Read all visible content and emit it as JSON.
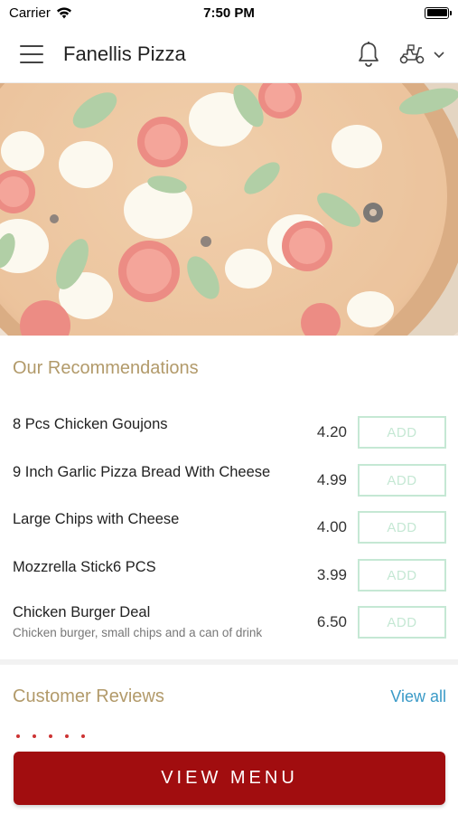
{
  "status_bar": {
    "carrier": "Carrier",
    "time": "7:50 PM"
  },
  "header": {
    "title": "Fanellis Pizza",
    "menu_icon": "hamburger-menu-icon",
    "bell_icon": "bell-icon",
    "delivery_icon": "scooter-icon",
    "dropdown_icon": "chevron-down-icon"
  },
  "hero": {
    "image": "pizza-photo"
  },
  "recommendations": {
    "title": "Our Recommendations",
    "items": [
      {
        "name": "8 Pcs Chicken Goujons",
        "description": "",
        "price": "4.20",
        "button": "ADD"
      },
      {
        "name": "9 Inch Garlic Pizza Bread With Cheese",
        "description": "",
        "price": "4.99",
        "button": "ADD"
      },
      {
        "name": "Large Chips with Cheese",
        "description": "",
        "price": "4.00",
        "button": "ADD"
      },
      {
        "name": "Mozzrella Stick6 PCS",
        "description": "",
        "price": "3.99",
        "button": "ADD"
      },
      {
        "name": "Chicken Burger Deal",
        "description": "Chicken burger, small chips and a can of drink",
        "price": "6.50",
        "button": "ADD"
      }
    ]
  },
  "reviews": {
    "title": "Customer Reviews",
    "view_all": "View all"
  },
  "footer": {
    "view_menu": "VIEW MENU"
  },
  "colors": {
    "brand_red": "#a10d0f",
    "section_title": "#b29a6a",
    "add_button": "#c5e8d4",
    "link": "#3a9ac7"
  }
}
